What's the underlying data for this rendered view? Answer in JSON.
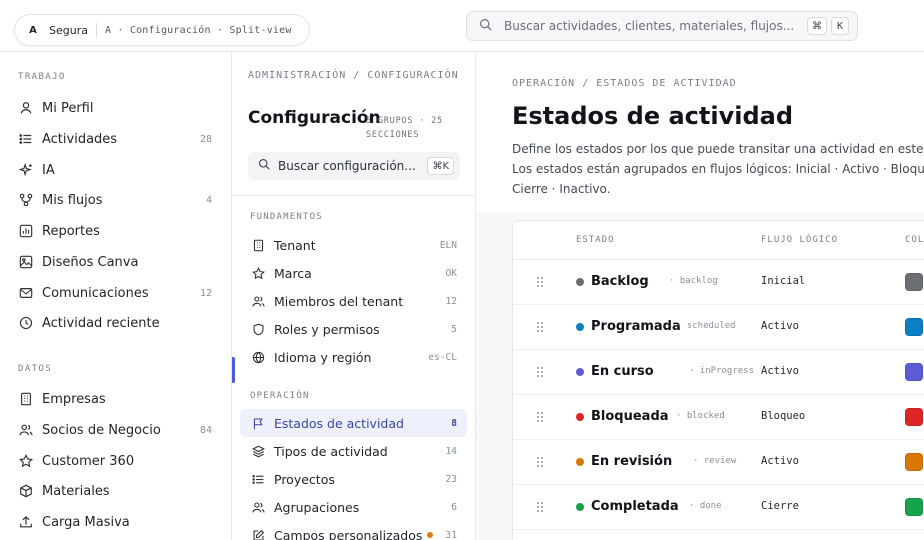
{
  "topbar": {
    "tenant_avatar": "A",
    "tenant_name": "Segura",
    "path": "A · Configuración · Split-view",
    "search_placeholder": "Buscar actividades, clientes, materiales, flujos...",
    "search_kbd_1": "⌘",
    "search_kbd_2": "K"
  },
  "sidebar": {
    "sections": [
      {
        "title": "TRABAJO",
        "items": [
          {
            "label": "Mi Perfil",
            "icon": "user-icon",
            "count": ""
          },
          {
            "label": "Actividades",
            "icon": "list-icon",
            "count": "28"
          },
          {
            "label": "IA",
            "icon": "sparkle-icon",
            "count": ""
          },
          {
            "label": "Mis flujos",
            "icon": "flow-icon",
            "count": "4"
          },
          {
            "label": "Reportes",
            "icon": "chart-icon",
            "count": ""
          },
          {
            "label": "Diseños Canva",
            "icon": "image-icon",
            "count": ""
          },
          {
            "label": "Comunicaciones",
            "icon": "mail-icon",
            "count": "12"
          },
          {
            "label": "Actividad reciente",
            "icon": "clock-icon",
            "count": ""
          }
        ]
      },
      {
        "title": "DATOS",
        "items": [
          {
            "label": "Empresas",
            "icon": "building-icon",
            "count": ""
          },
          {
            "label": "Socios de Negocio",
            "icon": "users-icon",
            "count": "84"
          },
          {
            "label": "Customer 360",
            "icon": "star-icon",
            "count": ""
          },
          {
            "label": "Materiales",
            "icon": "box-icon",
            "count": ""
          },
          {
            "label": "Carga Masiva",
            "icon": "upload-icon",
            "count": ""
          }
        ]
      }
    ]
  },
  "settings": {
    "breadcrumb": "ADMINISTRACIÓN / CONFIGURACIÓN",
    "title": "Configuración",
    "meta": "5 GRUPOS · 25 SECCIONES",
    "search_placeholder": "Buscar configuración...",
    "search_kbd": "⌘K",
    "groups": [
      {
        "title": "FUNDAMENTOS",
        "items": [
          {
            "label": "Tenant",
            "icon": "building-icon",
            "badge": "ELN"
          },
          {
            "label": "Marca",
            "icon": "star-icon",
            "badge": "OK"
          },
          {
            "label": "Miembros del tenant",
            "icon": "users-icon",
            "badge": "12"
          },
          {
            "label": "Roles y permisos",
            "icon": "shield-icon",
            "badge": "5"
          },
          {
            "label": "Idioma y región",
            "icon": "globe-icon",
            "badge": "es-CL"
          }
        ]
      },
      {
        "title": "OPERACIÓN",
        "items": [
          {
            "label": "Estados de actividad",
            "icon": "flag-icon",
            "badge": "8"
          },
          {
            "label": "Tipos de actividad",
            "icon": "layers-icon",
            "badge": "14"
          },
          {
            "label": "Proyectos",
            "icon": "list-icon",
            "badge": "23"
          },
          {
            "label": "Agrupaciones",
            "icon": "users-icon",
            "badge": "6"
          },
          {
            "label": "Campos personalizados",
            "icon": "edit-icon",
            "badge": "31"
          }
        ]
      }
    ]
  },
  "main": {
    "breadcrumb": "OPERACIÓN / ESTADOS DE ACTIVIDAD",
    "title": "Estados de actividad",
    "description": "Define los estados por los que puede transitar una actividad en este tenant. Los estados están agrupados en flujos lógicos: Inicial · Activo · Bloqueo · Cierre · Inactivo.",
    "columns": {
      "estado": "ESTADO",
      "flujo": "FLUJO LÓGICO",
      "color": "COLOR"
    },
    "rows": [
      {
        "name": "Backlog",
        "key": "· backlog",
        "flow": "Inicial",
        "color": "#6b6e74"
      },
      {
        "name": "Programada",
        "key": "· scheduled",
        "flow": "Activo",
        "color": "#0a7fc4"
      },
      {
        "name": "En curso",
        "key": "· inProgress",
        "flow": "Activo",
        "color": "#5b5bd6"
      },
      {
        "name": "Bloqueada",
        "key": "· blocked",
        "flow": "Bloqueo",
        "color": "#dc2626"
      },
      {
        "name": "En revisión",
        "key": "· review",
        "flow": "Activo",
        "color": "#d97706"
      },
      {
        "name": "Completada",
        "key": "· done",
        "flow": "Cierre",
        "color": "#16a34a"
      }
    ]
  }
}
